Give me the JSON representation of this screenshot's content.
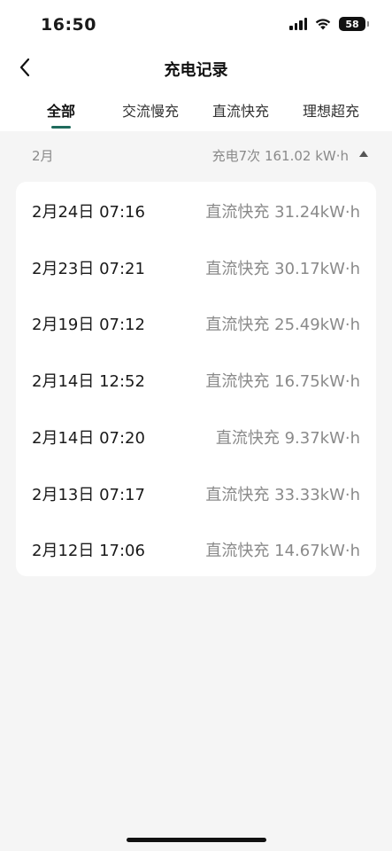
{
  "status_bar": {
    "time": "16:50",
    "battery": "58"
  },
  "nav": {
    "title": "充电记录"
  },
  "tabs": [
    {
      "label": "全部",
      "active": true
    },
    {
      "label": "交流慢充",
      "active": false
    },
    {
      "label": "直流快充",
      "active": false
    },
    {
      "label": "理想超充",
      "active": false
    }
  ],
  "month": {
    "label": "2月",
    "summary": "充电7次 161.02 kW·h"
  },
  "records": [
    {
      "date": "2月24日 07:16",
      "detail": "直流快充 31.24kW·h"
    },
    {
      "date": "2月23日 07:21",
      "detail": "直流快充 30.17kW·h"
    },
    {
      "date": "2月19日 07:12",
      "detail": "直流快充 25.49kW·h"
    },
    {
      "date": "2月14日 12:52",
      "detail": "直流快充 16.75kW·h"
    },
    {
      "date": "2月14日 07:20",
      "detail": "直流快充 9.37kW·h"
    },
    {
      "date": "2月13日 07:17",
      "detail": "直流快充 33.33kW·h"
    },
    {
      "date": "2月12日 17:06",
      "detail": "直流快充 14.67kW·h"
    }
  ],
  "colors": {
    "accent": "#1f6b5c",
    "muted_text": "#8a8a8a",
    "background": "#f5f5f5"
  },
  "icons": {
    "back": "chevron-left-icon",
    "collapse": "triangle-up-icon",
    "signal": "signal-icon",
    "wifi": "wifi-icon",
    "battery": "battery-icon"
  }
}
